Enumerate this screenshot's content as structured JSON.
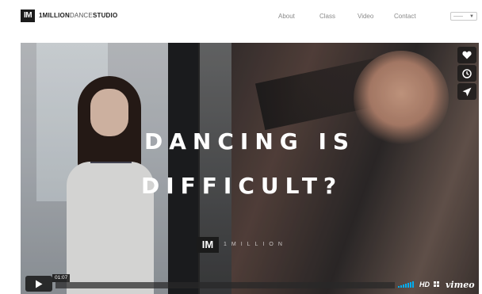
{
  "header": {
    "logo_mark": "IM",
    "logo_bold_1": "1MILLION",
    "logo_light": "DANCE",
    "logo_bold_2": "STUDIO",
    "nav": [
      "About",
      "Class",
      "Video",
      "Contact"
    ],
    "lang_select": {
      "value": "------",
      "arrow": "▼"
    }
  },
  "video": {
    "headline_line1": "DANCING IS",
    "headline_line2": "DIFFICULT?",
    "brand_mark": "IM",
    "brand_text": "1MILLION",
    "side_buttons": [
      {
        "name": "like",
        "icon": "heart-icon"
      },
      {
        "name": "watch-later",
        "icon": "clock-icon"
      },
      {
        "name": "share",
        "icon": "paper-plane-icon"
      }
    ],
    "controls": {
      "play_icon": "play-icon",
      "time": "01:07",
      "progress": 0,
      "hd_label": "HD",
      "vimeo_label": "vimeo"
    }
  },
  "colors": {
    "accent": "#00adef",
    "dark": "#1b1b1b"
  }
}
